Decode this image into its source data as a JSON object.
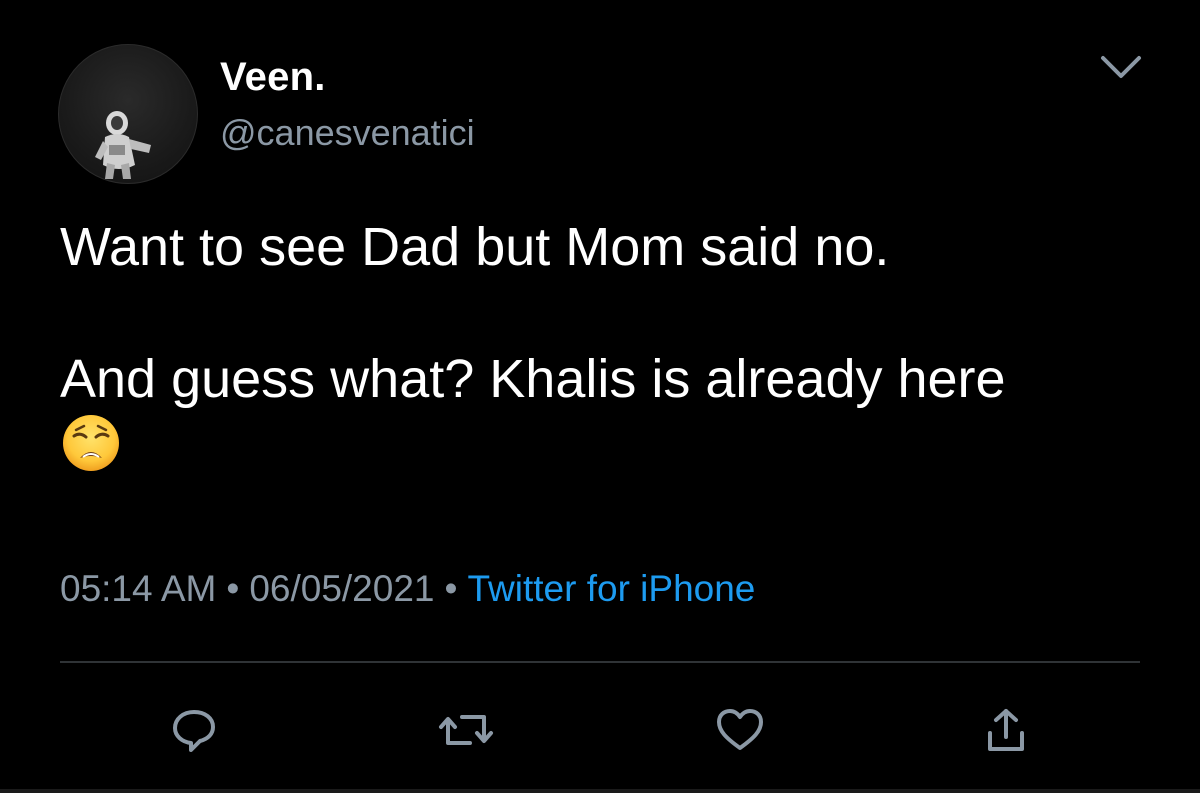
{
  "tweet": {
    "display_name": "Veen.",
    "handle": "@canesvenatici",
    "text_line1": "Want to see Dad but Mom said no.",
    "text_line2": "And guess what? Khalis is already here",
    "emoji": "😩",
    "time": "05:14 AM",
    "date": "06/05/2021",
    "separator": "•",
    "source": "Twitter for iPhone"
  },
  "icons": {
    "menu": "chevron-down-icon",
    "reply": "reply-icon",
    "retweet": "retweet-icon",
    "like": "heart-icon",
    "share": "share-icon"
  },
  "colors": {
    "background": "#000000",
    "text": "#ffffff",
    "secondary": "#8b98a5",
    "link": "#1d9bf0",
    "divider": "#2f3336"
  }
}
